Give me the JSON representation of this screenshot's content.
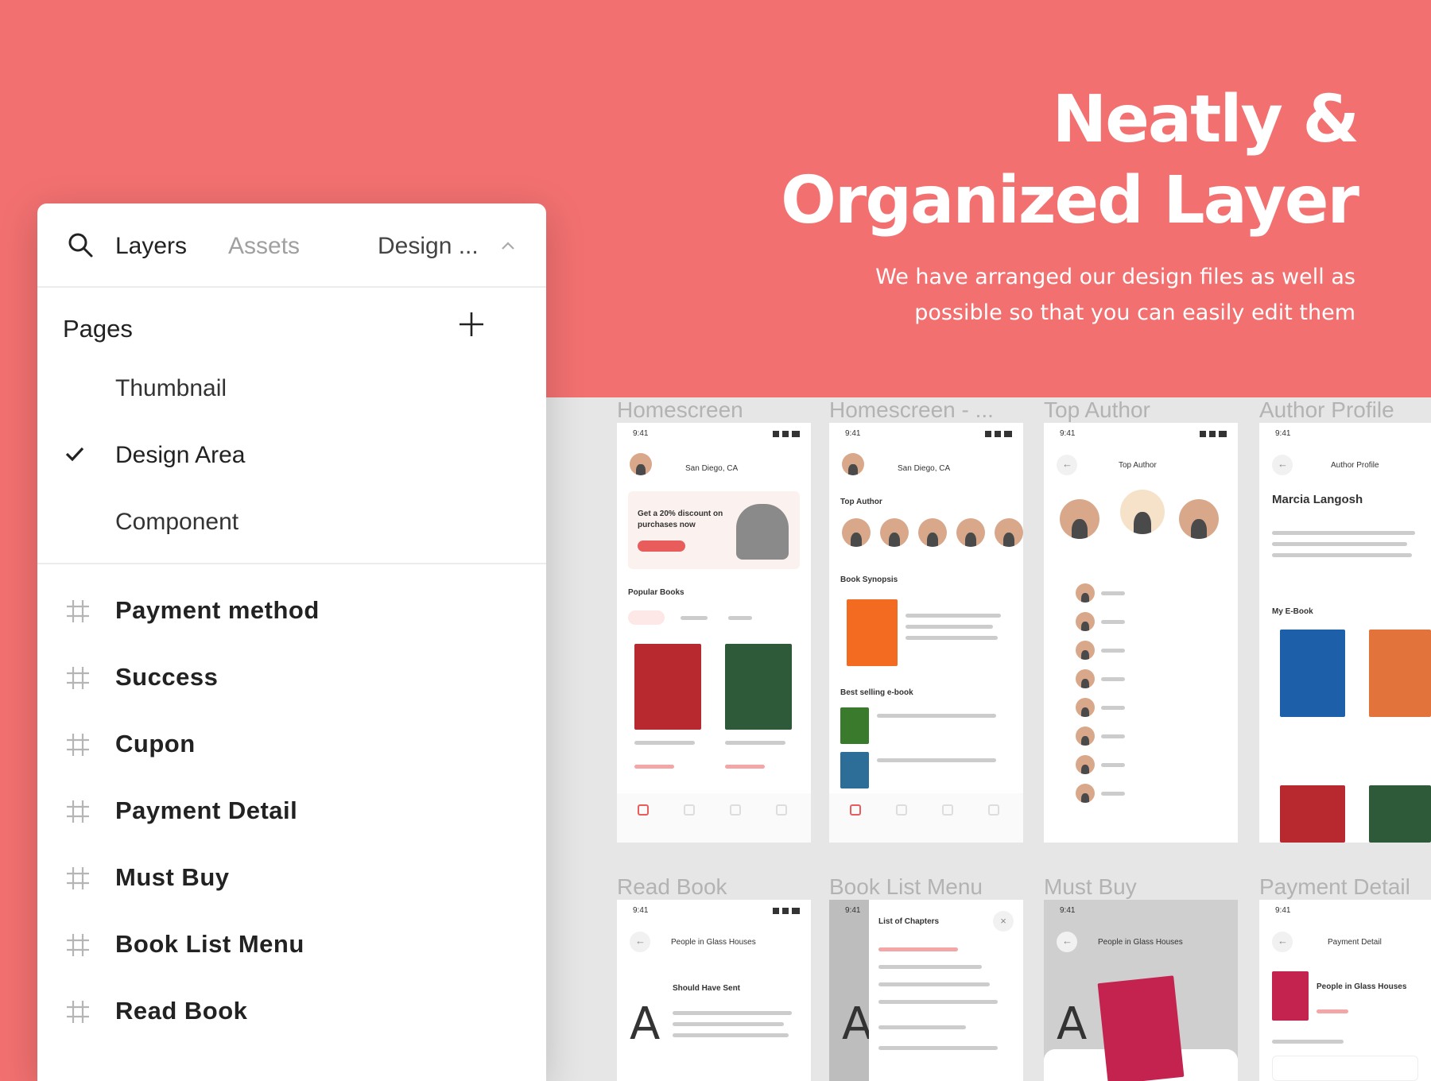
{
  "hero": {
    "title_line1": "Neatly &",
    "title_line2": "Organized Layer",
    "subtitle_line1": "We have arranged our design files as well as",
    "subtitle_line2": "possible so that you can easily edit them"
  },
  "panel": {
    "tabs": {
      "layers": "Layers",
      "assets": "Assets",
      "page_select": "Design ..."
    },
    "pages_heading": "Pages",
    "pages": [
      "Thumbnail",
      "Design Area",
      "Component"
    ],
    "selected_page": "Design Area",
    "layers": [
      "Payment method",
      "Success",
      "Cupon",
      "Payment Detail",
      "Must Buy",
      "Book List Menu",
      "Read Book"
    ]
  },
  "frames": {
    "row1": [
      "Homescreen",
      "Homescreen - ...",
      "Top Author",
      "Author Profile"
    ],
    "row2": [
      "Read Book",
      "Book List Menu",
      "Must Buy",
      "Payment Detail"
    ]
  },
  "mock": {
    "time": "9:41",
    "location": "San Diego, CA",
    "promo": "Get a 20% discount on purchases now",
    "popular": "Popular Books",
    "top_author": "Top Author",
    "book_synopsis": "Book Synopsis",
    "best_selling": "Best selling e-book",
    "author_name": "Marcia Langosh",
    "my_ebook": "My E-Book",
    "author_profile": "Author Profile",
    "chapter_title": "Should Have Sent",
    "book_title": "People in Glass Houses",
    "chapters_title": "List of Chapters",
    "payment_detail": "Payment Detail",
    "big_letter": "A"
  },
  "colors": {
    "background": "#f27070",
    "canvas": "#e6e6e6",
    "panel": "#ffffff",
    "accent": "#e85c5c"
  }
}
